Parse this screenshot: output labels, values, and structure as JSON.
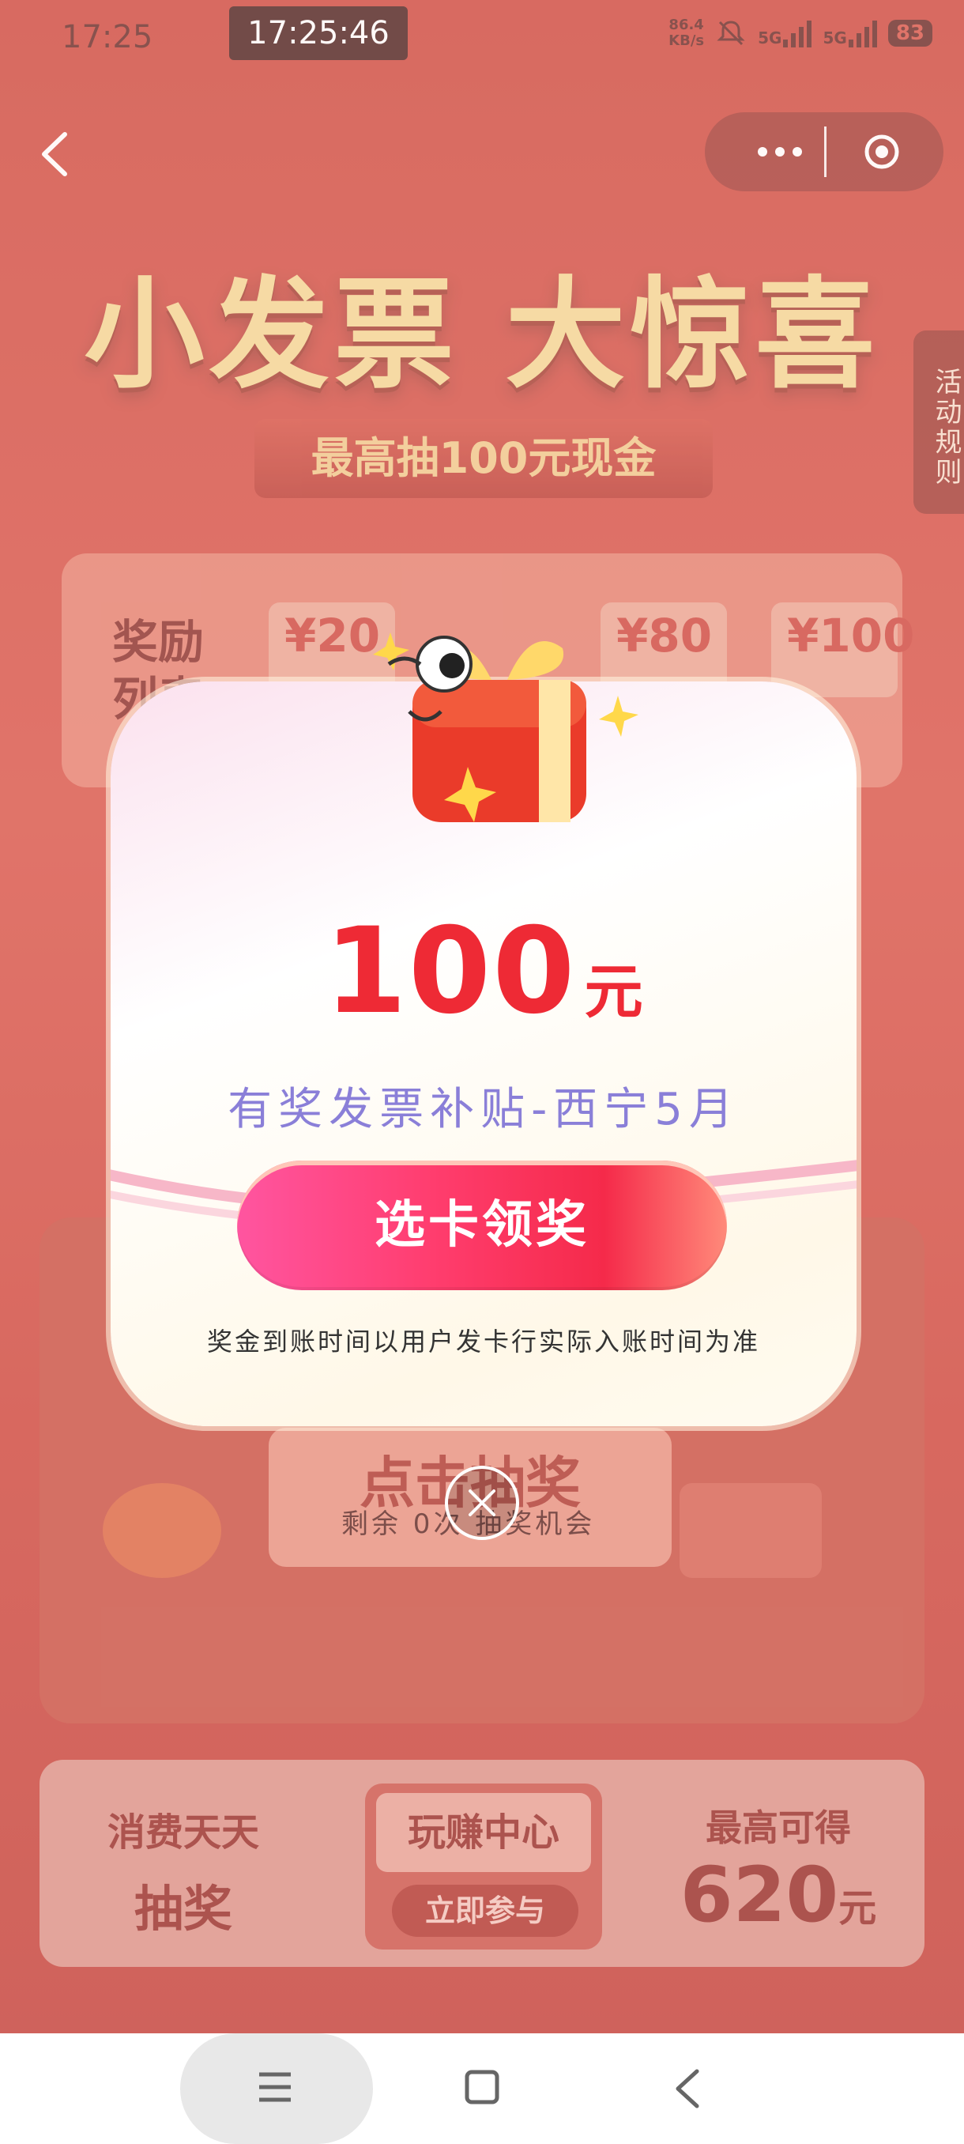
{
  "status_bar": {
    "time": "17:25",
    "clock_chip": "17:25:46",
    "net_speed_value": "86.4",
    "net_speed_unit": "KB/s",
    "sim1": "5G",
    "sim2": "5G",
    "battery": "83"
  },
  "rules_tab": "活动规则",
  "headline": {
    "title": "小发票 大惊喜",
    "subtitle": "最高抽100元现金"
  },
  "prize_list": {
    "title": "奖励列表",
    "chips": [
      "¥20",
      "¥80",
      "¥100"
    ]
  },
  "draw": {
    "label": "点击抽奖",
    "remaining": "剩余 0次 抽奖机会"
  },
  "bottom_banner": {
    "left_line1": "消费天天",
    "left_line2": "抽奖",
    "mid_title": "玩赚中心",
    "mid_button": "立即参与",
    "right_line1": "最高可得",
    "right_value": "620",
    "right_unit": "元"
  },
  "modal": {
    "amount": "100",
    "amount_unit": "元",
    "subsidy_name": "有奖发票补贴-西宁5月",
    "claim_button": "选卡领奖",
    "notice": "奖金到账时间以用户发卡行实际入账时间为准"
  },
  "colors": {
    "accent_red": "#ee2a35",
    "subsidy_purple": "#8a7fd8",
    "page_red": "#c9362c"
  },
  "icons": [
    "chevron-left-icon",
    "more-icon",
    "close-circle-icon",
    "gift-mascot-icon",
    "menu-icon",
    "home-icon",
    "back-icon"
  ]
}
